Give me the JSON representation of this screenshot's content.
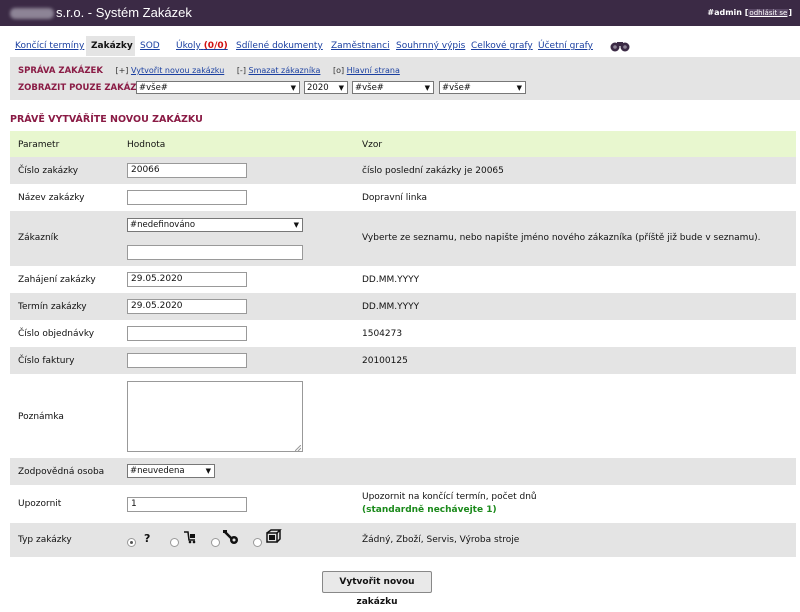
{
  "app": {
    "title": "s.r.o. - Systém Zakázek",
    "user": "#admin",
    "logout": "odhlásit se"
  },
  "tabs": [
    {
      "label": "Končící termíny"
    },
    {
      "label": "Zakázky"
    },
    {
      "label": "SOD"
    },
    {
      "label": "Úkoly",
      "badge": "(0/0)"
    },
    {
      "label": "Sdílené dokumenty"
    },
    {
      "label": "Zaměstnanci"
    },
    {
      "label": "Souhrnný výpis"
    },
    {
      "label": "Celkové grafy"
    },
    {
      "label": "Účetní grafy"
    }
  ],
  "tab_icon": "binoculars-icon",
  "panel": {
    "title": "SPRÁVA ZAKÁZEK",
    "actions": [
      {
        "prefix": "[+]",
        "label": "Vytvořit novou zakázku"
      },
      {
        "prefix": "[-]",
        "label": "Smazat zákazníka"
      },
      {
        "prefix": "[o]",
        "label": "Hlavní strana"
      }
    ],
    "filter_title": "ZOBRAZIT POUZE ZAKÁZKY",
    "filters": [
      "#vše#",
      "2020",
      "#vše#",
      "#vše#"
    ]
  },
  "section_title": "PRÁVĚ VYTVÁŘÍTE NOVOU ZAKÁZKU",
  "table": {
    "headers": [
      "Parametr",
      "Hodnota",
      "Vzor"
    ],
    "rows": {
      "cislo": {
        "label": "Číslo zakázky",
        "value": "20066",
        "hint": "číslo poslední zakázky je 20065"
      },
      "nazev": {
        "label": "Název zakázky",
        "value": "",
        "hint": "Dopravní linka"
      },
      "zakaznik": {
        "label": "Zákazník",
        "select": "#nedefinováno",
        "value": "",
        "hint": "Vyberte ze seznamu, nebo napište jméno nového zákazníka (příště již bude v seznamu)."
      },
      "zahajeni": {
        "label": "Zahájení zakázky",
        "value": "29.05.2020",
        "hint": "DD.MM.YYYY"
      },
      "termin": {
        "label": "Termín zakázky",
        "value": "29.05.2020",
        "hint": "DD.MM.YYYY"
      },
      "objednavka": {
        "label": "Číslo objednávky",
        "value": "",
        "hint": "1504273"
      },
      "faktura": {
        "label": "Číslo faktury",
        "value": "",
        "hint": "20100125"
      },
      "poznamka": {
        "label": "Poznámka",
        "value": ""
      },
      "osoba": {
        "label": "Zodpovědná osoba",
        "select": "#neuvedena"
      },
      "upozornit": {
        "label": "Upozornit",
        "value": "1",
        "hint": "Upozornit na končící termín, počet dnů",
        "hint2": "(standardně nechávejte 1)"
      },
      "typ": {
        "label": "Typ zakázky",
        "hint": "Žádný, Zboží, Servis, Výroba stroje",
        "options": [
          "?",
          "goods-icon",
          "service-icon",
          "machine-icon"
        ],
        "selected": 0
      }
    }
  },
  "submit_label": "Vytvořit novou zakázku"
}
